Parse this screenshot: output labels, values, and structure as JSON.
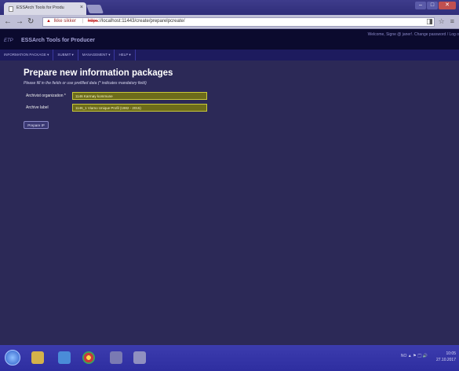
{
  "browser": {
    "tab_title": "ESSArch Tools for Produ",
    "tab_close": "×",
    "address": {
      "security_label": "Ikke sikker",
      "url_protocol": "https",
      "url_rest": "://localhost:11443/create/prepareIpcreate/"
    }
  },
  "app": {
    "logo_text": "ETP",
    "name": "ESSArch Tools for Producer",
    "user_menu": "Welcome, Signe @ janer!. Change password / Log o"
  },
  "nav": {
    "items": [
      "INFORMATION PACKAGE ▾",
      "SUBMIT ▾",
      "MANAGEMENT ▾",
      "HELP ▾"
    ]
  },
  "page": {
    "title": "Prepare new information packages",
    "subtitle": "Please fill in the fields or use prefilled data (* indicates mandatory field)",
    "form": {
      "archivist_org_label": "Archivist organization *",
      "archivist_org_value": "1146 Karmøy kommune",
      "archive_label_label": "Archive label",
      "archive_label_value": "1146_1 Viamo Unique Profil (1982 - 2015)"
    },
    "prepare_button": "Prepare IP"
  },
  "taskbar": {
    "tray_text": "NO ▲ ⚑ 🗔 🔊",
    "time": "10:05",
    "date": "27.10.2017"
  }
}
